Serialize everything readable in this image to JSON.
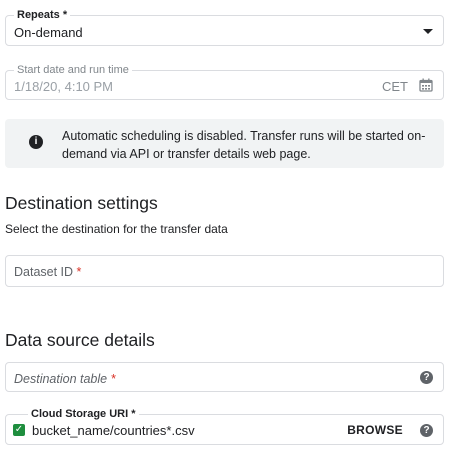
{
  "repeats": {
    "label": "Repeats",
    "required_mark": "*",
    "value": "On-demand"
  },
  "start_date": {
    "label": "Start date and run time",
    "value": "1/18/20, 4:10 PM",
    "timezone": "CET",
    "icon": "calendar-icon"
  },
  "info": {
    "icon": "info-icon",
    "text": "Automatic scheduling is disabled. Transfer runs will be started on-demand via API or transfer details web page."
  },
  "destination": {
    "title": "Destination settings",
    "subtitle": "Select the destination for the transfer data",
    "dataset_placeholder": "Dataset ID",
    "required_mark": "*"
  },
  "data_source": {
    "title": "Data source details",
    "destination_table_placeholder": "Destination table",
    "required_mark": "*",
    "help_icon": "help-icon"
  },
  "gcs": {
    "label": "Cloud Storage URI",
    "required_mark": "*",
    "value": "bucket_name/countries*.csv",
    "browse_label": "BROWSE",
    "valid_icon": "check-icon",
    "help_icon": "help-icon"
  },
  "colors": {
    "valid": "#1e8e3e",
    "required": "#d93025",
    "info_bg": "#f1f3f4"
  }
}
